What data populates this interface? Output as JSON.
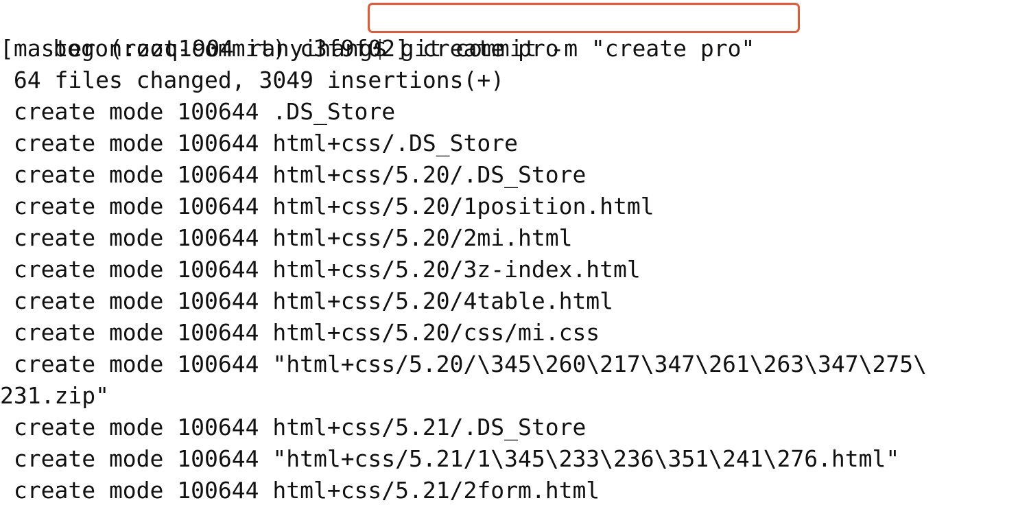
{
  "terminal": {
    "prompt": "bogon:zzq1904 ranyihang$",
    "command": " git commit -m \"create pro\"",
    "highlight_color": "#e8572f",
    "output_lines": [
      "[master (root-commit) c3f9f02] create pro",
      " 64 files changed, 3049 insertions(+)",
      " create mode 100644 .DS_Store",
      " create mode 100644 html+css/.DS_Store",
      " create mode 100644 html+css/5.20/.DS_Store",
      " create mode 100644 html+css/5.20/1position.html",
      " create mode 100644 html+css/5.20/2mi.html",
      " create mode 100644 html+css/5.20/3z-index.html",
      " create mode 100644 html+css/5.20/4table.html",
      " create mode 100644 html+css/5.20/css/mi.css",
      " create mode 100644 \"html+css/5.20/\\345\\260\\217\\347\\261\\263\\347\\275\\",
      "231.zip\"",
      " create mode 100644 html+css/5.21/.DS_Store",
      " create mode 100644 \"html+css/5.21/1\\345\\233\\236\\351\\241\\276.html\"",
      " create mode 100644 html+css/5.21/2form.html"
    ]
  }
}
